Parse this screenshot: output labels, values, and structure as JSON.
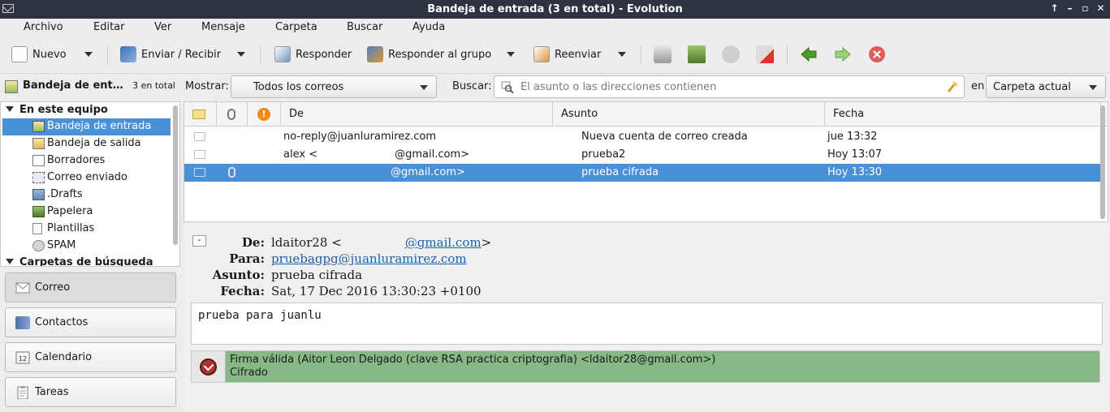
{
  "window": {
    "title": "Bandeja de entrada (3 en total) - Evolution"
  },
  "menu": [
    "Archivo",
    "Editar",
    "Ver",
    "Mensaje",
    "Carpeta",
    "Buscar",
    "Ayuda"
  ],
  "toolbar": {
    "new": "Nuevo",
    "send_receive": "Enviar / Recibir",
    "reply": "Responder",
    "reply_group": "Responder al grupo",
    "forward": "Reenviar"
  },
  "folder_header": {
    "name": "Bandeja de ent…",
    "count": "3 en total"
  },
  "filter": {
    "show_label": "Mostrar:",
    "show_value": "Todos los correos",
    "search_label": "Buscar:",
    "search_placeholder": "El asunto o las direcciones contienen",
    "in_label": "en",
    "scope_value": "Carpeta actual"
  },
  "tree": {
    "group1": "En este equipo",
    "folders": [
      {
        "label": "Bandeja de entrada",
        "icon": "inbox-icon"
      },
      {
        "label": "Bandeja de salida",
        "icon": "outbox-icon"
      },
      {
        "label": "Borradores",
        "icon": "drafts-icon"
      },
      {
        "label": "Correo enviado",
        "icon": "sent-icon"
      },
      {
        "label": ".Drafts",
        "icon": "folder-icon"
      },
      {
        "label": "Papelera",
        "icon": "trash-icon"
      },
      {
        "label": "Plantillas",
        "icon": "templates-icon"
      },
      {
        "label": "SPAM",
        "icon": "spam-icon"
      }
    ],
    "group2": "Carpetas de búsqueda"
  },
  "nav": {
    "mail": "Correo",
    "contacts": "Contactos",
    "calendar": "Calendario",
    "tasks": "Tareas"
  },
  "list": {
    "columns": {
      "from": "De",
      "subject": "Asunto",
      "date": "Fecha"
    },
    "rows": [
      {
        "from": "no-reply@juanluramirez.com",
        "subject": "Nueva cuenta de correo creada",
        "date": "jue 13:32"
      },
      {
        "from": "alex <                       @gmail.com>",
        "subject": "prueba2",
        "date": "Hoy 13:07"
      },
      {
        "from": "@gmail.com>",
        "subject": "prueba cifrada",
        "date": "Hoy 13:30"
      }
    ]
  },
  "preview": {
    "from_label": "De:",
    "from_name": "ldaitor28 <",
    "from_email": "@gmail.com",
    "from_close": ">",
    "to_label": "Para:",
    "to_value": "pruebagpg@juanluramirez.com",
    "subject_label": "Asunto:",
    "subject_value": "prueba cifrada",
    "date_label": "Fecha:",
    "date_value": "Sat, 17 Dec 2016 13:30:23 +0100",
    "body": "prueba para juanlu",
    "signature": "Firma válida (Aitor Leon Delgado (clave RSA practica criptografia) <ldaitor28@gmail.com>)",
    "encryption": "Cifrado"
  },
  "colors": {
    "selection": "#4a90d9",
    "signature_ok": "#86b985",
    "titlebar": "#2d3340"
  }
}
